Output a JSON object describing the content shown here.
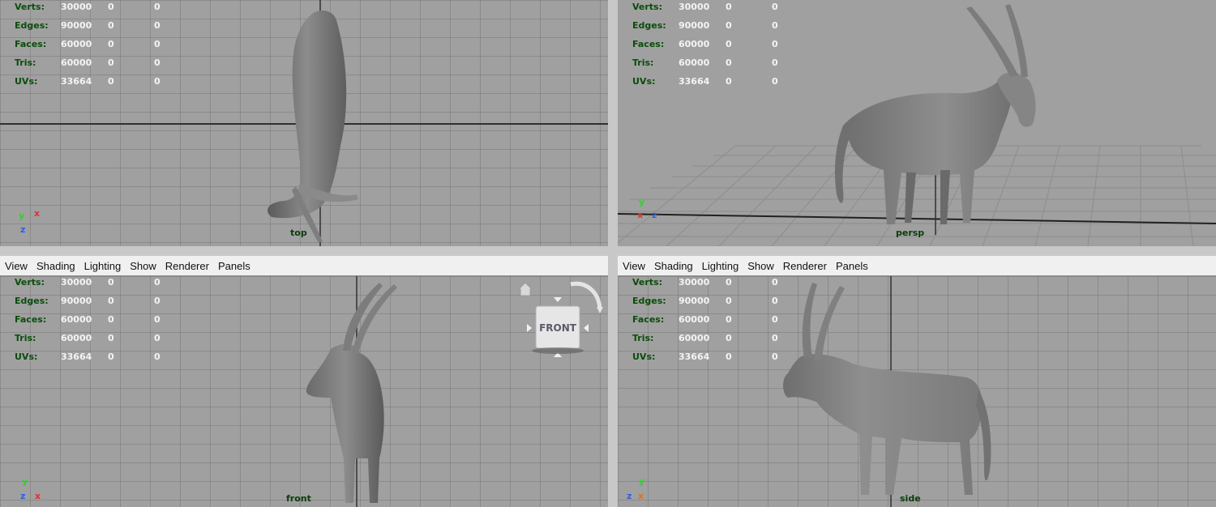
{
  "stats": {
    "labels": [
      "Verts:",
      "Edges:",
      "Faces:",
      "Tris:",
      "UVs:"
    ],
    "values": [
      [
        "30000",
        "0",
        "0"
      ],
      [
        "90000",
        "0",
        "0"
      ],
      [
        "60000",
        "0",
        "0"
      ],
      [
        "60000",
        "0",
        "0"
      ],
      [
        "33664",
        "0",
        "0"
      ]
    ]
  },
  "menus": [
    "View",
    "Shading",
    "Lighting",
    "Show",
    "Renderer",
    "Panels"
  ],
  "viewports": {
    "top": "top",
    "persp": "persp",
    "front": "front",
    "side": "side"
  },
  "viewcube": {
    "label": "FRONT"
  },
  "axis_labels": {
    "x": "x",
    "y": "y",
    "z": "z"
  },
  "colors": {
    "viewport_bg": "#a0a0a0",
    "grid": "#8f8f8f",
    "axis_x": "#e03030",
    "axis_y": "#30d030",
    "axis_z": "#3060e0",
    "hud_label": "#0a4d0a",
    "model": "#7a7a7a"
  }
}
